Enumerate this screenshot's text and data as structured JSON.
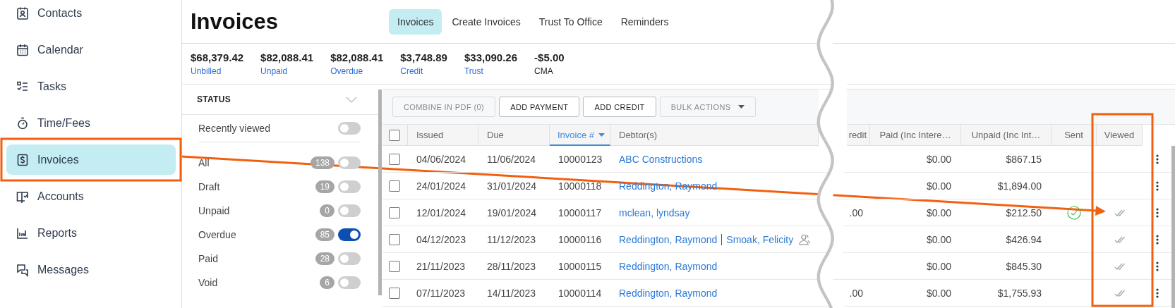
{
  "sidebar": {
    "items": [
      {
        "label": "Contacts",
        "kind": "contact",
        "selected": false
      },
      {
        "label": "Calendar",
        "kind": "calendar",
        "selected": false
      },
      {
        "label": "Tasks",
        "kind": "tasks",
        "selected": false
      },
      {
        "label": "Time/Fees",
        "kind": "timer",
        "selected": false
      },
      {
        "label": "Invoices",
        "kind": "invoice",
        "selected": true
      },
      {
        "label": "Accounts",
        "kind": "book",
        "selected": false
      },
      {
        "label": "Reports",
        "kind": "chart",
        "selected": false
      },
      {
        "label": "Messages",
        "kind": "chat",
        "selected": false
      }
    ]
  },
  "header": {
    "title": "Invoices",
    "tabs": [
      {
        "label": "Invoices",
        "selected": true
      },
      {
        "label": "Create Invoices",
        "selected": false
      },
      {
        "label": "Trust To Office",
        "selected": false
      },
      {
        "label": "Reminders",
        "selected": false
      }
    ]
  },
  "summary": [
    {
      "amount": "$68,379.42",
      "label": "Unbilled",
      "link": true
    },
    {
      "amount": "$82,088.41",
      "label": "Unpaid",
      "link": true
    },
    {
      "amount": "$82,088.41",
      "label": "Overdue",
      "link": true
    },
    {
      "amount": "$3,748.89",
      "label": "Credit",
      "link": true
    },
    {
      "amount": "$33,090.26",
      "label": "Trust",
      "link": true
    },
    {
      "amount": "-$5.00",
      "label": "CMA",
      "link": false
    }
  ],
  "filters": {
    "title": "STATUS",
    "recently_viewed": {
      "label": "Recently viewed",
      "on": false
    },
    "items": [
      {
        "label": "All",
        "count": "138",
        "on": false
      },
      {
        "label": "Draft",
        "count": "19",
        "on": false
      },
      {
        "label": "Unpaid",
        "count": "0",
        "on": false
      },
      {
        "label": "Overdue",
        "count": "85",
        "on": true
      },
      {
        "label": "Paid",
        "count": "28",
        "on": false
      },
      {
        "label": "Void",
        "count": "6",
        "on": false
      }
    ]
  },
  "toolbar": {
    "buttons": [
      {
        "label": "COMBINE IN PDF (0)",
        "disabled": true,
        "dropdown": false
      },
      {
        "label": "ADD PAYMENT",
        "disabled": false,
        "dropdown": false
      },
      {
        "label": "ADD CREDIT",
        "disabled": false,
        "dropdown": false
      },
      {
        "label": "BULK ACTIONS",
        "disabled": true,
        "dropdown": true
      }
    ]
  },
  "table": {
    "all_selected": false,
    "columns": [
      {
        "label": "Issued",
        "sorted": false
      },
      {
        "label": "Due",
        "sorted": false
      },
      {
        "label": "Invoice #",
        "sorted": true
      },
      {
        "label": "Debtor(s)",
        "sorted": false
      },
      {
        "label": "redit",
        "sorted": false
      },
      {
        "label": "Paid (Inc Intere…",
        "sorted": false
      },
      {
        "label": "Unpaid (Inc Int…",
        "sorted": false
      },
      {
        "label": "Sent",
        "sorted": false
      },
      {
        "label": "Viewed",
        "sorted": false
      }
    ],
    "rows": [
      {
        "selected": false,
        "issued": "04/06/2024",
        "due": "11/06/2024",
        "number": "10000123",
        "debtors": [
          "ABC Constructions"
        ],
        "paid": "$0.00",
        "unpaid": "$867.15",
        "sent": false,
        "viewed": false
      },
      {
        "selected": false,
        "issued": "24/01/2024",
        "due": "31/01/2024",
        "number": "10000118",
        "debtors": [
          "Reddington, Raymond"
        ],
        "paid": "$0.00",
        "unpaid": "$1,894.00",
        "sent": false,
        "viewed": false
      },
      {
        "selected": false,
        "issued": "12/01/2024",
        "due": "19/01/2024",
        "number": "10000117",
        "debtors": [
          "mclean, lyndsay"
        ],
        "credit": ".00",
        "paid": "$0.00",
        "unpaid": "$212.50",
        "sent": true,
        "viewed": true
      },
      {
        "selected": false,
        "issued": "04/12/2023",
        "due": "11/12/2023",
        "number": "10000116",
        "debtors": [
          "Reddington, Raymond",
          "Smoak, Felicity"
        ],
        "paid": "$0.00",
        "unpaid": "$426.94",
        "sent": false,
        "viewed": true
      },
      {
        "selected": false,
        "issued": "21/11/2023",
        "due": "28/11/2023",
        "number": "10000115",
        "debtors": [
          "Reddington, Raymond"
        ],
        "paid": "$0.00",
        "unpaid": "$845.30",
        "sent": false,
        "viewed": true
      },
      {
        "selected": false,
        "issued": "07/11/2023",
        "due": "14/11/2023",
        "number": "10000114",
        "debtors": [
          "Reddington, Raymond"
        ],
        "credit": ".00",
        "paid": "$0.00",
        "unpaid": "$1,755.93",
        "sent": false,
        "viewed": true
      }
    ]
  }
}
